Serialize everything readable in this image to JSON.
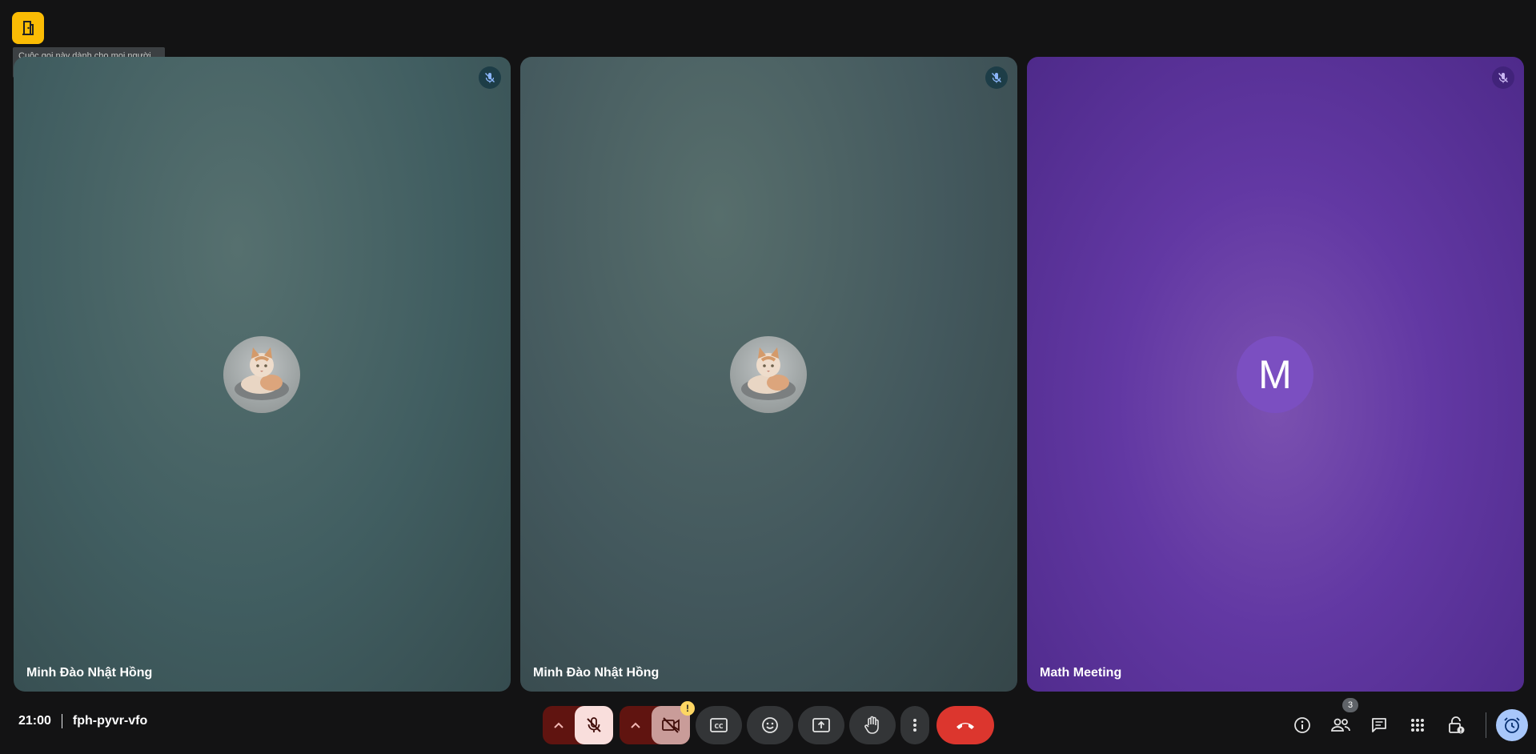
{
  "host_badge": {
    "icon": "door-icon",
    "tooltip": "Cuộc gọi này dành cho mọi người"
  },
  "tiles": [
    {
      "name": "Minh Đào Nhật Hồng",
      "avatar": "cat-photo",
      "muted": true
    },
    {
      "name": "Minh Đào Nhật Hồng",
      "avatar": "cat-photo",
      "muted": true
    },
    {
      "name": "Math Meeting",
      "avatar_letter": "M",
      "muted": true
    }
  ],
  "meeting": {
    "time": "21:00",
    "code": "fph-pyvr-vfo"
  },
  "controls": {
    "mic": {
      "icon": "mic-off-icon",
      "state": "off"
    },
    "camera": {
      "icon": "video-off-icon",
      "state": "off",
      "warning": "!"
    },
    "captions": {
      "icon": "captions-icon"
    },
    "reactions": {
      "icon": "emoji-icon"
    },
    "present": {
      "icon": "present-screen-icon"
    },
    "raise_hand": {
      "icon": "hand-icon"
    },
    "more": {
      "icon": "more-vert-icon"
    },
    "leave": {
      "icon": "call-end-icon",
      "color": "#dc362e"
    }
  },
  "right_panel": {
    "people_count": "3",
    "icons": [
      "info-icon",
      "people-icon",
      "chat-icon",
      "activities-icon",
      "host-controls-icon",
      "timer-icon"
    ]
  },
  "colors": {
    "background": "#131314",
    "host_badge": "#fbbc04",
    "leave": "#dc362e",
    "purple_tile": "#6238a3"
  }
}
